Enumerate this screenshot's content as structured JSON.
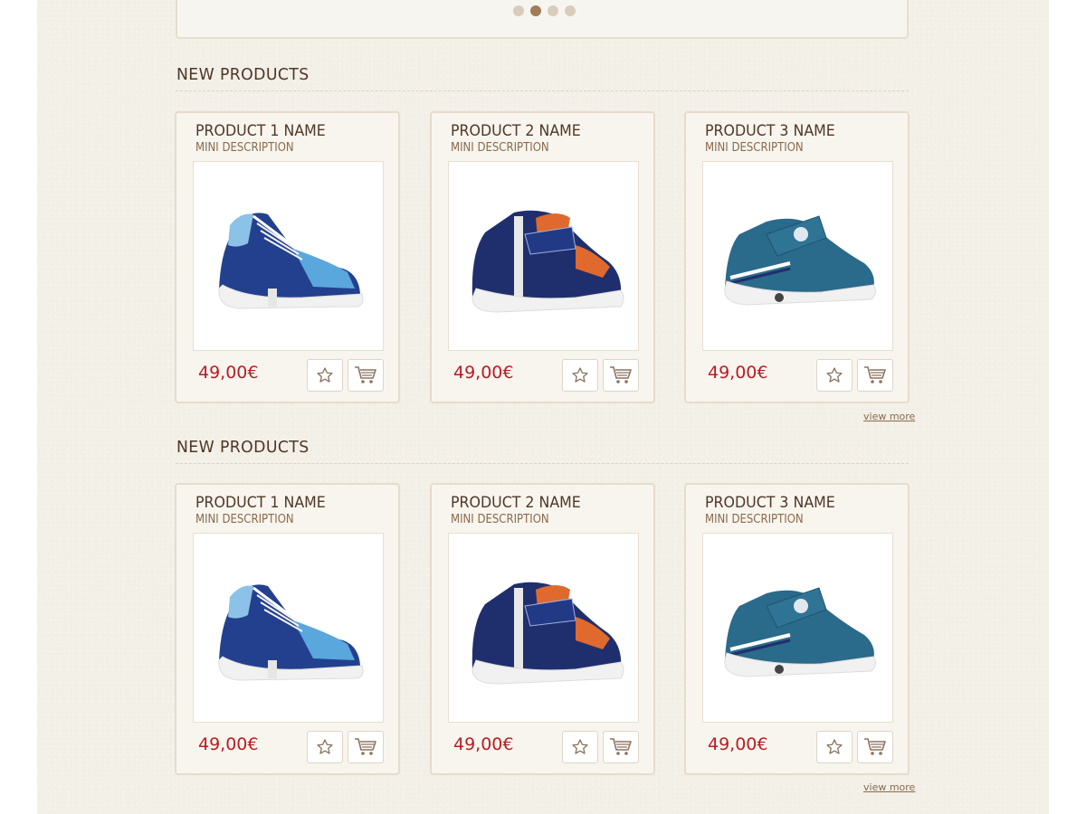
{
  "slider": {
    "dots": [
      {
        "label": "slide-1",
        "active": false
      },
      {
        "label": "slide-2",
        "active": true
      },
      {
        "label": "slide-3",
        "active": false
      },
      {
        "label": "slide-4",
        "active": false
      }
    ]
  },
  "sections": [
    {
      "title": "NEW PRODUCTS",
      "view_more": "view more",
      "products": [
        {
          "name": "PRODUCT 1 NAME",
          "description": "MINI DESCRIPTION",
          "price": "49,00€",
          "shoe": "lace-up-blue"
        },
        {
          "name": "PRODUCT 2 NAME",
          "description": "MINI DESCRIPTION",
          "price": "49,00€",
          "shoe": "zip-navy-orange"
        },
        {
          "name": "PRODUCT 3 NAME",
          "description": "MINI DESCRIPTION",
          "price": "49,00€",
          "shoe": "strap-teal"
        }
      ]
    },
    {
      "title": "NEW PRODUCTS",
      "view_more": "view more",
      "products": [
        {
          "name": "PRODUCT 1 NAME",
          "description": "MINI DESCRIPTION",
          "price": "49,00€",
          "shoe": "lace-up-blue"
        },
        {
          "name": "PRODUCT 2 NAME",
          "description": "MINI DESCRIPTION",
          "price": "49,00€",
          "shoe": "zip-navy-orange"
        },
        {
          "name": "PRODUCT 3 NAME",
          "description": "MINI DESCRIPTION",
          "price": "49,00€",
          "shoe": "strap-teal"
        }
      ]
    }
  ],
  "icons": {
    "favorite": "star-icon",
    "cart": "cart-icon"
  },
  "colors": {
    "price": "#b81d24",
    "title": "#4f3726",
    "accent": "#a07c58"
  }
}
